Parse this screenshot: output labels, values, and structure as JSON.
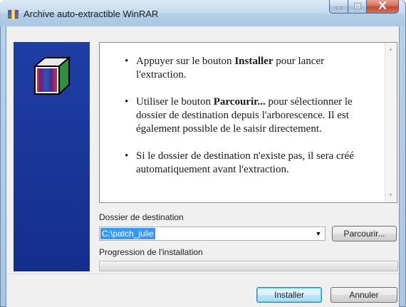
{
  "window": {
    "title": "Archive auto-extractible WinRAR",
    "icon": "winrar-icon",
    "controls": [
      "minimize-icon",
      "maximize-icon",
      "close-icon"
    ]
  },
  "info": {
    "items": [
      {
        "before": "Appuyer sur le bouton ",
        "bold": "Installer",
        "after": " pour lancer l'extraction."
      },
      {
        "before": "Utiliser le bouton ",
        "bold": "Parcourir...",
        "after": " pour sélectionner le dossier de destination depuis l'arborescence. Il est également possible de le saisir directement."
      },
      {
        "before": "",
        "bold": "",
        "after": "Si le dossier de destination n'existe pas, il sera créé automatiquement avant l'extraction."
      }
    ]
  },
  "destination": {
    "label": "Dossier de destination",
    "value": "C:\\patch_julie",
    "browse_label": "Parcourir..."
  },
  "progress": {
    "label": "Progression de l'installation",
    "value": 0
  },
  "buttons": {
    "install": "Installer",
    "cancel": "Annuler"
  },
  "colors": {
    "sidebar": "#1c3b9c",
    "selection": "#3399ff",
    "close_button": "#c14a2f"
  }
}
